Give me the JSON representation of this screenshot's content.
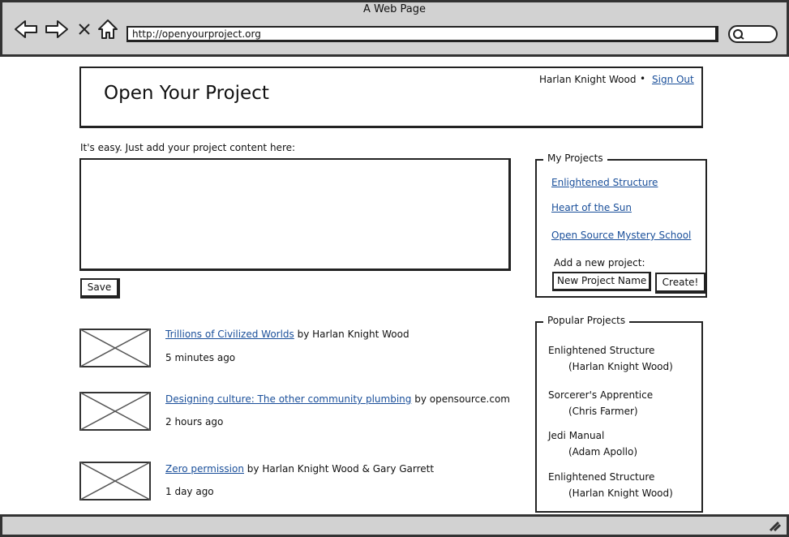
{
  "browser": {
    "window_title": "A Web Page",
    "url": "http://openyourproject.org"
  },
  "header": {
    "site_title": "Open Your Project",
    "user_name": "Harlan Knight Wood",
    "separator": "•",
    "sign_out": "Sign Out"
  },
  "editor": {
    "intro": "It's easy.  Just add your project content here:",
    "save_label": "Save"
  },
  "feed": [
    {
      "title": "Trillions of Civilized Worlds",
      "by": " by Harlan Knight Wood",
      "time": "5 minutes ago"
    },
    {
      "title": "Designing culture: The other community plumbing",
      "by": " by opensource.com",
      "time": "2 hours ago"
    },
    {
      "title": "Zero permission",
      "by": " by Harlan Knight Wood & Gary Garrett",
      "time": "1 day ago"
    }
  ],
  "my_projects": {
    "heading": "My Projects",
    "items": [
      "Enlightened Structure",
      "Heart of the Sun",
      "Open Source Mystery School"
    ],
    "add_label": "Add a new project:",
    "input_value": "New Project Name",
    "create_label": "Create!"
  },
  "popular_projects": {
    "heading": "Popular Projects",
    "items": [
      {
        "title": "Enlightened Structure",
        "author": "(Harlan Knight Wood)"
      },
      {
        "title": "Sorcerer's Apprentice",
        "author": "(Chris Farmer)"
      },
      {
        "title": "Jedi Manual",
        "author": "(Adam Apollo)"
      },
      {
        "title": "Enlightened Structure",
        "author": "(Harlan Knight Wood)"
      }
    ]
  },
  "colors": {
    "link": "#1a4f9a",
    "chrome": "#d2d2d2",
    "border": "#222222"
  }
}
